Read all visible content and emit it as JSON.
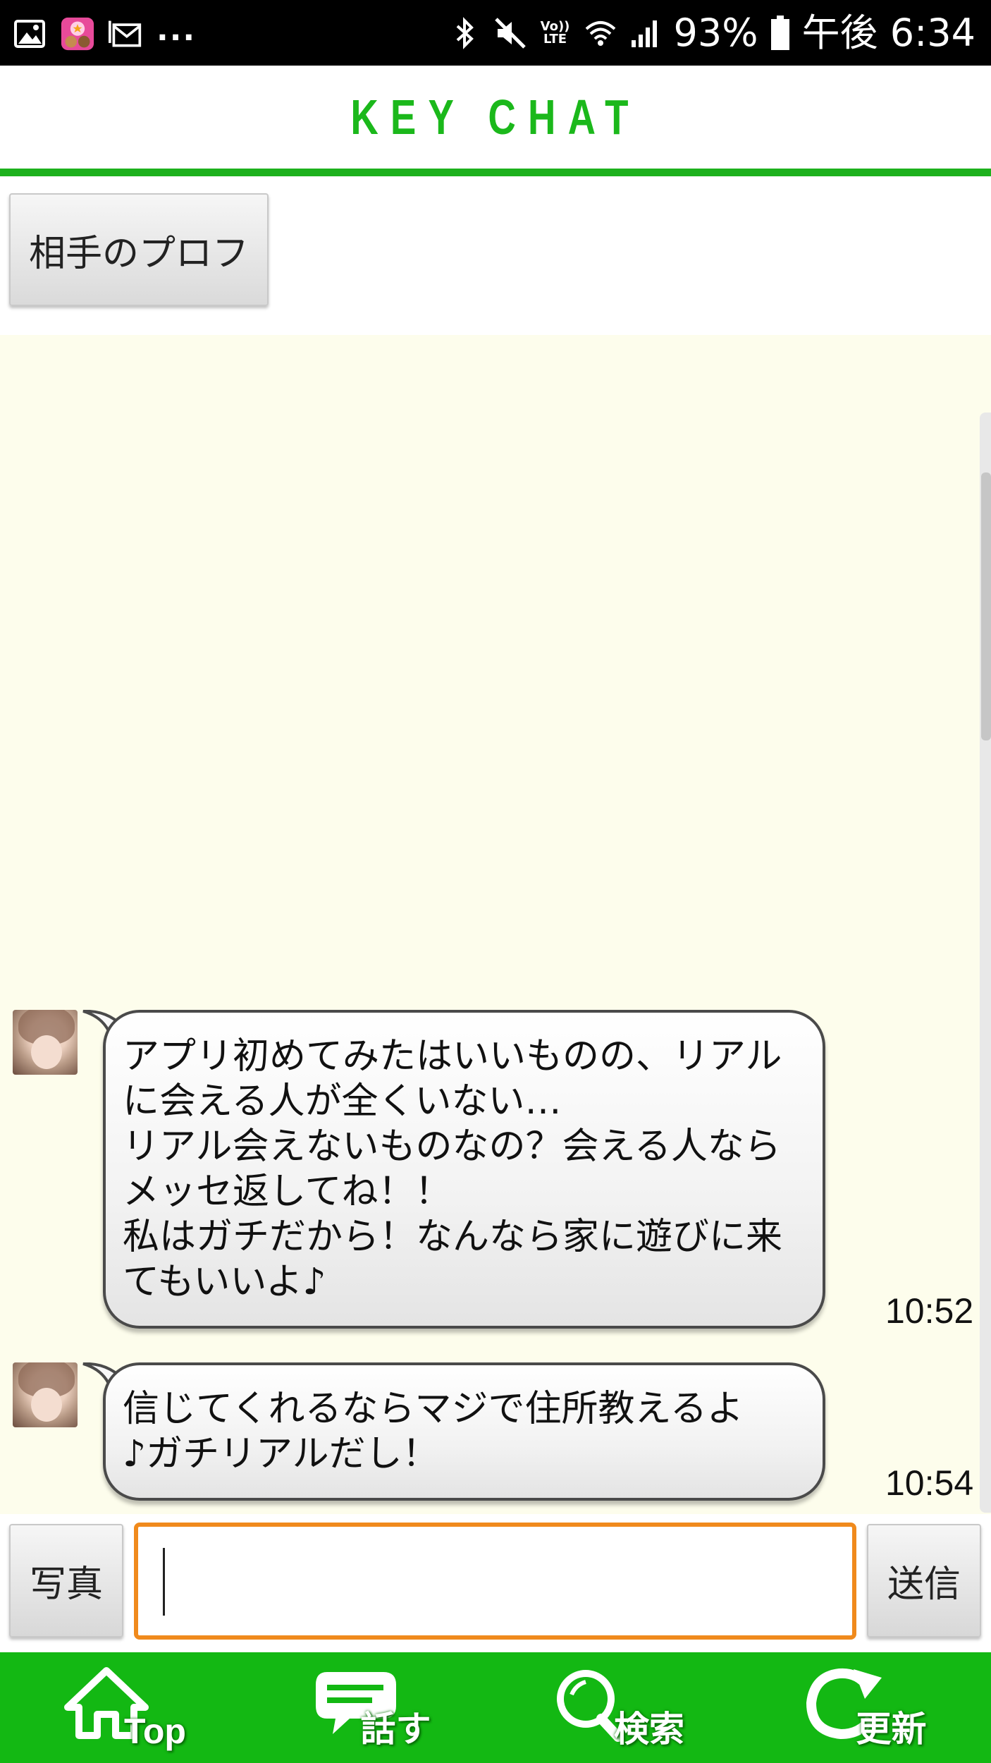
{
  "status_bar": {
    "battery": "93%",
    "time": "午後 6:34",
    "volte_line1": "Vo))",
    "volte_line2": "LTE",
    "more": "..."
  },
  "header": {
    "title": "KEY CHAT",
    "accent_color": "#1db11d"
  },
  "profile_button": {
    "label": "相手のプロフ"
  },
  "messages": [
    {
      "text": "アプリ初めてみたはいいものの、リアル\nに会える人が全くいない…\nリアル会えないものなの？会える人なら\nメッセ返してね！！\n私はガチだから！なんなら家に遊びに来\nてもいいよ♪",
      "time": "10:52"
    },
    {
      "text": "信じてくれるならマジで住所教えるよ\n♪ガチリアルだし！",
      "time": "10:54"
    }
  ],
  "input_bar": {
    "photo_label": "写真",
    "input_value": "",
    "input_placeholder": "",
    "send_label": "送信"
  },
  "bottom_nav": {
    "items": [
      {
        "label": "Top",
        "icon": "home-icon"
      },
      {
        "label": "話す",
        "icon": "chat-icon"
      },
      {
        "label": "検索",
        "icon": "search-icon"
      },
      {
        "label": "更新",
        "icon": "refresh-icon"
      }
    ],
    "color": "#13b813"
  }
}
